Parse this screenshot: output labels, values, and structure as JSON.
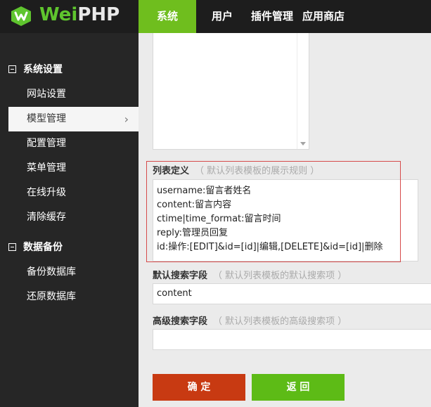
{
  "brand": {
    "name_part1": "Wei",
    "name_part2": "PHP"
  },
  "nav": {
    "items": [
      {
        "label": "系统",
        "active": true
      },
      {
        "label": "用户"
      },
      {
        "label": "插件管理"
      },
      {
        "label": "应用商店"
      }
    ]
  },
  "sidebar": {
    "groups": [
      {
        "label": "系统设置",
        "items": [
          "网站设置",
          "模型管理",
          "配置管理",
          "菜单管理",
          "在线升级",
          "清除缓存"
        ]
      },
      {
        "label": "数据备份",
        "items": [
          "备份数据库",
          "还原数据库"
        ]
      }
    ],
    "active_item": "模型管理",
    "chevron": "›"
  },
  "form": {
    "list_def": {
      "label": "列表定义",
      "hint": "（ 默认列表模板的展示规则 ）",
      "lines": [
        "username:留言者姓名",
        "content:留言内容",
        "ctime|time_format:留言时间",
        "reply:管理员回复",
        "id:操作:[EDIT]&id=[id]|编辑,[DELETE]&id=[id]|删除"
      ]
    },
    "search_field": {
      "label": "默认搜索字段",
      "hint": "（ 默认列表模板的默认搜索项 ）",
      "value": "content"
    },
    "adv_search": {
      "label": "高级搜索字段",
      "hint": "（ 默认列表模板的高级搜索项 ）",
      "value": ""
    },
    "buttons": {
      "ok": "确 定",
      "back": "返 回"
    }
  },
  "colors": {
    "accent_green": "#6fbe1e",
    "confirm_red": "#c83a12",
    "highlight_red": "#d64a4a"
  }
}
